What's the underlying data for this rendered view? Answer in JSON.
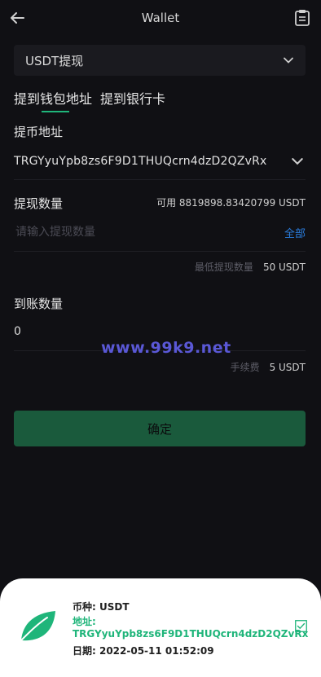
{
  "header": {
    "title": "Wallet",
    "back_icon": "arrow-left-icon",
    "record_icon": "clipboard-icon"
  },
  "currency_select": {
    "value": "USDT提现",
    "icon": "chevron-down-icon"
  },
  "tabs": [
    {
      "label": "提到钱包地址",
      "active": true
    },
    {
      "label": "提到银行卡",
      "active": false
    }
  ],
  "address": {
    "label": "提币地址",
    "value": "TRGYyuYpb8zs6F9D1THUQcrn4dzD2QZvRx"
  },
  "amount": {
    "label": "提现数量",
    "available": "可用 8819898.83420799 USDT",
    "placeholder": "请输入提现数量",
    "all_label": "全部",
    "min_label": "最低提现数量",
    "min_value": "50 USDT"
  },
  "arrival": {
    "label": "到账数量",
    "value": "0",
    "fee_label": "手续费",
    "fee_value": "5 USDT"
  },
  "watermark": "www.99k9.net",
  "confirm_label": "确定",
  "toast": {
    "currency": "币种: USDT",
    "address_label": "地址:",
    "address_value": "TRGYyuYpb8zs6F9D1THUQcrn4dzD2QZvRx",
    "date": "日期: 2022-05-11 01:52:09",
    "accent_color": "#1fb57a",
    "logo_icon": "leaf-icon",
    "check_icon": "checkbox-checked-icon"
  }
}
